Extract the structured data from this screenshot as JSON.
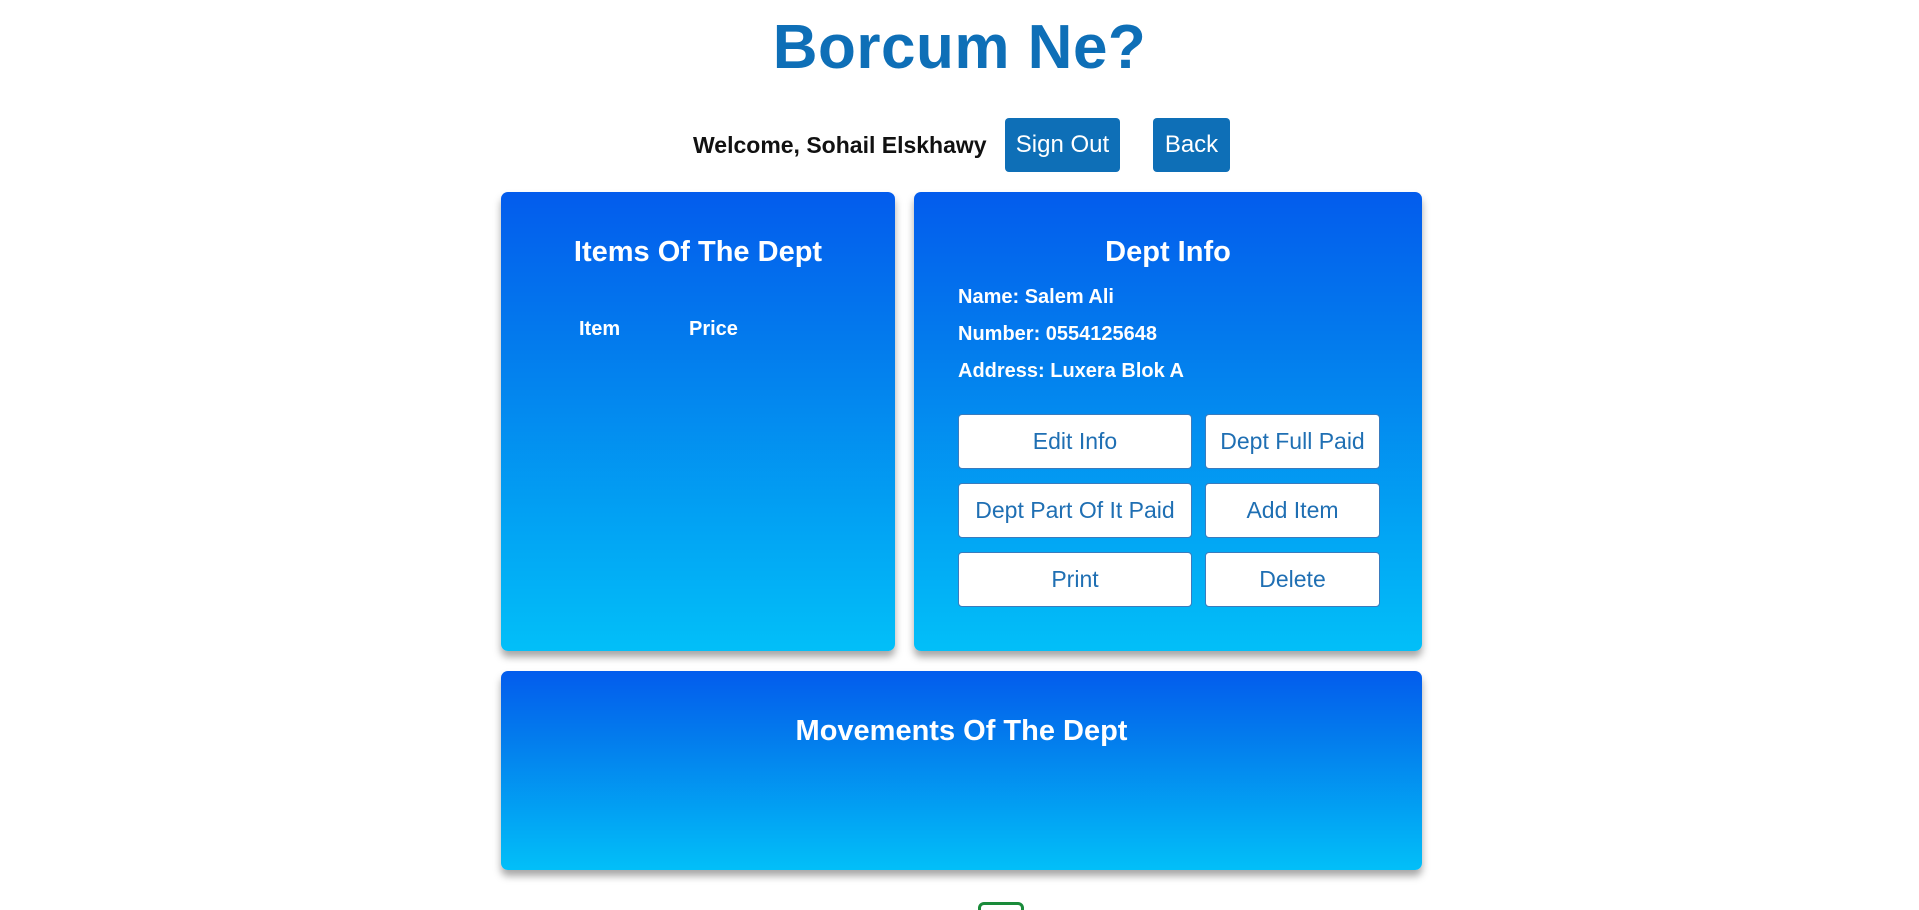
{
  "header": {
    "title": "Borcum Ne?",
    "welcome_text": "Welcome, Sohail Elskhawy",
    "sign_out_label": "Sign Out",
    "back_label": "Back"
  },
  "items_panel": {
    "title": "Items Of The Dept",
    "columns": [
      "Item",
      "Price"
    ]
  },
  "info_panel": {
    "title": "Dept Info",
    "name_line": "Name: Salem Ali",
    "number_line": "Number: 0554125648",
    "address_line": "Address: Luxera Blok A",
    "actions": {
      "edit_info": "Edit Info",
      "full_paid": "Dept Full Paid",
      "part_paid": "Dept Part Of It Paid",
      "add_item": "Add Item",
      "print": "Print",
      "delete": "Delete"
    }
  },
  "movements_panel": {
    "title": "Movements Of The Dept"
  },
  "colors": {
    "brand_blue": "#0e6fb7",
    "panel_gradient_top": "#035ced",
    "panel_gradient_bottom": "#02bff8",
    "button_text": "#1f6fb3"
  },
  "footer": {
    "logo_icon": "brackets-logo-icon"
  }
}
